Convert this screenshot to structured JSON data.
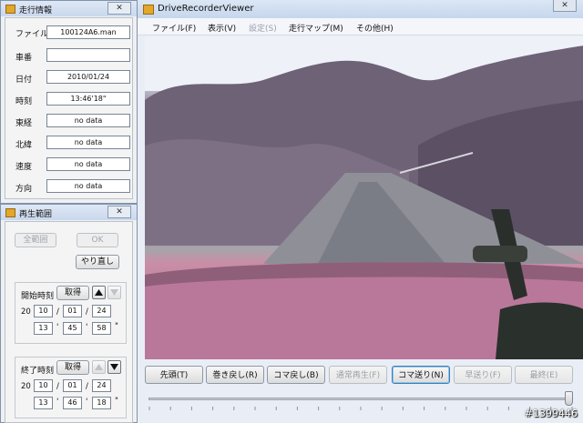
{
  "main": {
    "title": "DriveRecorderViewer",
    "close_glyph": "✕",
    "menu": [
      {
        "label": "ファイル(F)",
        "enabled": true
      },
      {
        "label": "表示(V)",
        "enabled": true
      },
      {
        "label": "設定(S)",
        "enabled": false
      },
      {
        "label": "走行マップ(M)",
        "enabled": true
      },
      {
        "label": "その他(H)",
        "enabled": true
      }
    ],
    "controls": [
      {
        "label": "先頭(T)",
        "enabled": true
      },
      {
        "label": "巻き戻し(R)",
        "enabled": true
      },
      {
        "label": "コマ戻し(B)",
        "enabled": true
      },
      {
        "label": "通常再生(F)",
        "enabled": false
      },
      {
        "label": "コマ送り(N)",
        "enabled": true
      },
      {
        "label": "早送り(F)",
        "enabled": false
      },
      {
        "label": "最終(E)",
        "enabled": false
      }
    ],
    "slider_position": 1.0
  },
  "info_panel": {
    "title": "走行情報",
    "close_glyph": "✕",
    "rows": [
      {
        "label": "ファイル",
        "value": "100124A6.man"
      },
      {
        "label": "車番",
        "value": ""
      },
      {
        "label": "日付",
        "value": "2010/01/24"
      },
      {
        "label": "時刻",
        "value": "13:46'18\""
      },
      {
        "label": "東経",
        "value": "no data"
      },
      {
        "label": "北緯",
        "value": "no data"
      },
      {
        "label": "速度",
        "value": "no data"
      },
      {
        "label": "方向",
        "value": "no data"
      }
    ]
  },
  "range_panel": {
    "title": "再生範囲",
    "close_glyph": "✕",
    "all_range_label": "全範囲",
    "ok_label": "OK",
    "redo_label": "やり直し",
    "start": {
      "label": "開始時刻",
      "get_label": "取得",
      "century": "20",
      "year": "10",
      "month": "01",
      "day": "24",
      "hour": "13",
      "minute": "45",
      "second": "58",
      "sep_date": "/",
      "sep_min": "'",
      "sep_sec": "\""
    },
    "end": {
      "label": "終了時刻",
      "get_label": "取得",
      "century": "20",
      "year": "10",
      "month": "01",
      "day": "24",
      "hour": "13",
      "minute": "46",
      "second": "18",
      "sep_date": "/",
      "sep_min": "'",
      "sep_sec": "\""
    }
  },
  "watermark": "#1399446",
  "colors": {
    "titlebar": "#c9d8ed",
    "focus": "#3c7fb1",
    "icon": "#e2a72b"
  }
}
